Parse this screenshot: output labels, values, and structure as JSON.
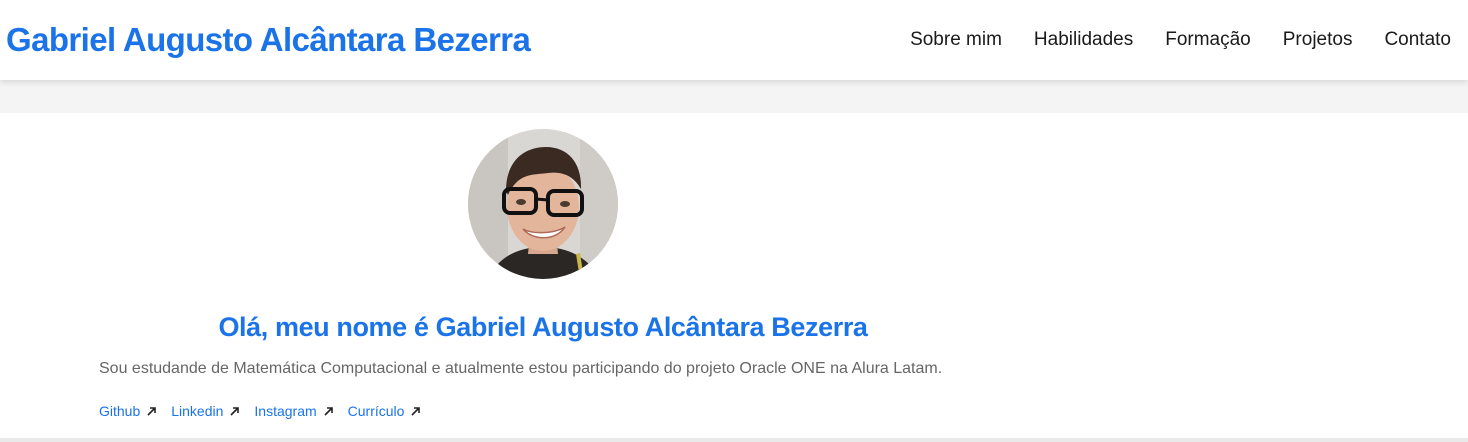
{
  "colors": {
    "accent": "#1a73e8",
    "text_dark": "#1a1a1a",
    "text_muted": "#666666",
    "page_bg": "#f4f4f4",
    "card_bg": "#ffffff"
  },
  "header": {
    "site_title": "Gabriel Augusto Alcântara Bezerra",
    "nav": [
      {
        "label": "Sobre mim"
      },
      {
        "label": "Habilidades"
      },
      {
        "label": "Formação"
      },
      {
        "label": "Projetos"
      },
      {
        "label": "Contato"
      }
    ]
  },
  "profile": {
    "avatar_icon": "profile-photo",
    "greeting": "Olá, meu nome é Gabriel Augusto Alcântara Bezerra",
    "bio": "Sou estudande de Matemática Computacional e atualmente estou participando do projeto Oracle ONE na Alura Latam.",
    "links": [
      {
        "label": "Github",
        "icon": "external-link-icon"
      },
      {
        "label": "Linkedin",
        "icon": "external-link-icon"
      },
      {
        "label": "Instagram",
        "icon": "external-link-icon"
      },
      {
        "label": "Currículo",
        "icon": "external-link-icon"
      }
    ]
  }
}
